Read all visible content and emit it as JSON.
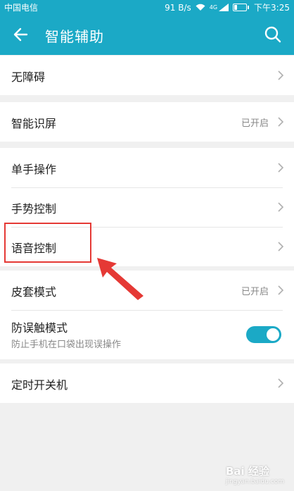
{
  "status_bar": {
    "carrier": "中国电信",
    "speed": "91 B/s",
    "network": "4G",
    "time": "下午3:25"
  },
  "header": {
    "title": "智能辅助",
    "back_icon": "arrow-left-icon",
    "search_icon": "search-icon"
  },
  "items": [
    {
      "label": "无障碍"
    },
    {
      "label": "智能识屏",
      "value": "已开启"
    },
    {
      "label": "单手操作"
    },
    {
      "label": "手势控制"
    },
    {
      "label": "语音控制"
    },
    {
      "label": "皮套模式",
      "value": "已开启"
    },
    {
      "label": "防误触模式",
      "subtitle": "防止手机在口袋出现误操作",
      "toggle_on": true
    },
    {
      "label": "定时开关机"
    }
  ],
  "watermark": {
    "text": "Bai 经验",
    "url": "jingyan.baidu.com"
  },
  "colors": {
    "accent": "#1ba9c6",
    "highlight": "#e53935"
  }
}
